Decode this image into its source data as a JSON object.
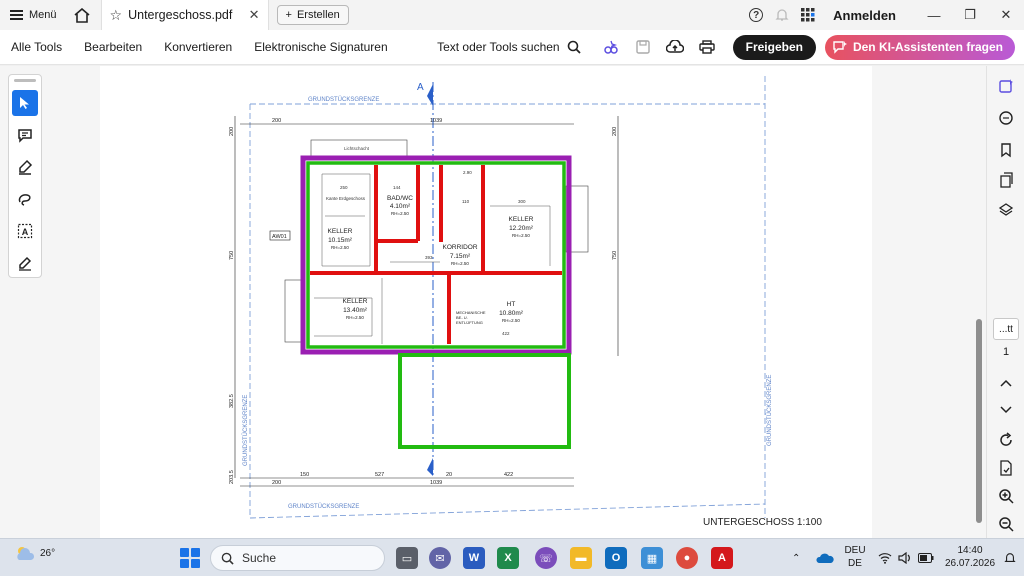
{
  "titlebar": {
    "menu_label": "Menü",
    "tab_title": "Untergeschoss.pdf",
    "new_tab_label": "Erstellen",
    "signin_label": "Anmelden"
  },
  "toolbar": {
    "menus": [
      "Alle Tools",
      "Bearbeiten",
      "Konvertieren",
      "Elektronische Signaturen"
    ],
    "search_label": "Text oder Tools suchen",
    "share_label": "Freigeben",
    "ai_label": "Den KI-Assistenten fragen"
  },
  "left_tools": [
    "select-tool",
    "comment-tool",
    "highlight-tool",
    "draw-tool",
    "text-select-tool",
    "fill-sign-tool"
  ],
  "right_rail": {
    "page_box_label": "...tt",
    "page_number": "1"
  },
  "drawing": {
    "property_line_top": "GRUNDSTÜCKSGRENZE",
    "property_line_bottom": "GRUNDSTÜCKSGRENZE",
    "property_line_left": "GRUNDSTÜCKSGRENZE",
    "property_line_right": "GRUNDSTÜCKSGRENZE",
    "section_marker": "A",
    "dim_top": [
      "200",
      "1039"
    ],
    "dim_bottom_1": [
      "150",
      "527",
      "20",
      "422"
    ],
    "dim_bottom_2": [
      "200",
      "1039"
    ],
    "dim_left": [
      "200",
      "750",
      "382.5",
      "203.5"
    ],
    "dim_right": [
      "200",
      "750"
    ],
    "inner_dims": [
      "250",
      "144",
      "110",
      "300",
      "393",
      "422",
      "2.90"
    ],
    "wall_tag": "AW01",
    "lichtschacht": "Lichtschacht",
    "kante": "Kante Erdgeschoss",
    "rooms": [
      {
        "name": "BAD/WC",
        "area": "4.10m²",
        "height": "RH=2.50"
      },
      {
        "name": "KELLER",
        "area": "10.15m²",
        "height": "RH=2.50"
      },
      {
        "name": "KORRIDOR",
        "area": "7.15m²",
        "height": "RH=2.50"
      },
      {
        "name": "KELLER",
        "area": "12.20m²",
        "height": "RH=2.50"
      },
      {
        "name": "KELLER",
        "area": "13.40m²",
        "height": "RH=2.50"
      },
      {
        "name": "HT",
        "area": "10.80m²",
        "height": "RH=2.50"
      }
    ],
    "mech_label": [
      "MECHANISCHE",
      "BE- U.",
      "ENTLÜFTUNG"
    ],
    "plan_title": "UNTERGESCHOSS 1:100"
  },
  "taskbar": {
    "temperature": "26°",
    "search_placeholder": "Suche",
    "lang_1": "DEU",
    "lang_2": "DE",
    "time": "14:40",
    "date": "26.07.2026"
  },
  "colors": {
    "accent": "#1a73e8",
    "wall_purple": "#9a1fb2",
    "wall_green": "#22bb11",
    "wall_red": "#e01010",
    "dim_blue": "#2a5fc9"
  }
}
